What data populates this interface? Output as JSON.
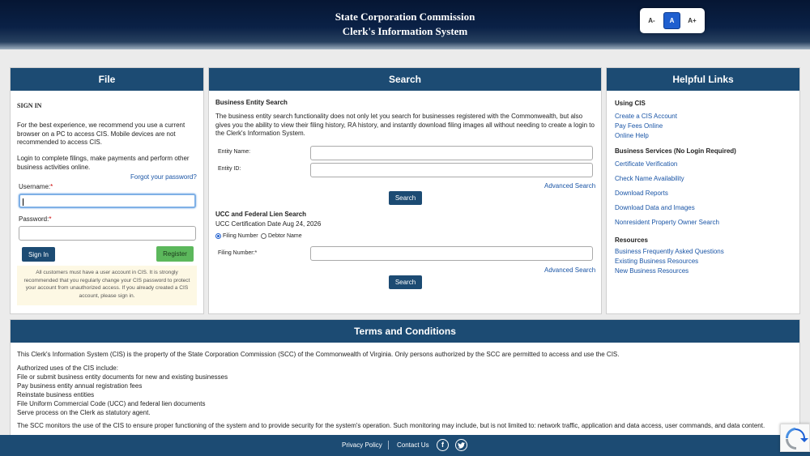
{
  "header": {
    "title_line1": "State Corporation Commission",
    "title_line2": "Clerk's Information System",
    "font_controls": [
      "A-",
      "A",
      "A+"
    ]
  },
  "file_panel": {
    "heading": "File",
    "sign_in_title": "SIGN IN",
    "experience_text": "For the best experience, we recommend you use a current browser on a PC to access CIS. Mobile devices are not recommended to access CIS.",
    "login_text": "Login to complete filings, make payments and perform other business activities online.",
    "forgot_password": "Forgot your password?",
    "username_label": "Username:",
    "password_label": "Password:",
    "required_mark": "*",
    "username_value": "",
    "password_value": "",
    "sign_in_button": "Sign In",
    "register_button": "Register",
    "notice": "All customers must have a user account in CIS. It is strongly recommended that you regularly change your CIS password to protect your account from unauthorized access. If you already created a CIS account, please sign in."
  },
  "search_panel": {
    "heading": "Search",
    "business_title": "Business Entity Search",
    "business_desc": "The business entity search functionality does not only let you search for businesses registered with the Commonwealth, but also gives you the ability to view their filing history, RA history, and instantly download filing images all without needing to create a login to the Clerk's Information System.",
    "entity_name_label": "Entity Name:",
    "entity_id_label": "Entity ID:",
    "advanced_search": "Advanced Search",
    "search_button": "Search",
    "ucc_title": "UCC and Federal Lien Search",
    "ucc_cert_date": "UCC Certification Date Aug 24, 2026",
    "radio_filing": "Filing Number",
    "radio_debtor": "Debtor Name",
    "filing_number_label": "Filing Number:",
    "required_mark": "*"
  },
  "helpful_links": {
    "heading": "Helpful Links",
    "using_cis_title": "Using CIS",
    "using_cis": [
      "Create a CIS Account",
      "Pay Fees Online",
      "Online Help"
    ],
    "business_services_title": "Business Services (No Login Required)",
    "business_services": [
      "Certificate Verification",
      "Check Name Availability",
      "Download Reports",
      "Download Data and Images",
      "Nonresident Property Owner Search"
    ],
    "resources_title": "Resources",
    "resources": [
      "Business Frequently Asked Questions",
      "Existing Business Resources",
      "New Business Resources"
    ]
  },
  "terms": {
    "heading": "Terms and Conditions",
    "intro": "This Clerk's Information System (CIS) is the property of the State Corporation Commission (SCC) of the Commonwealth of Virginia. Only persons authorized by the SCC are permitted to access and use the CIS.",
    "uses_title": "Authorized uses of the CIS include:",
    "uses": [
      "File or submit business entity documents for new and existing businesses",
      "Pay business entity annual registration fees",
      "Reinstate business entities",
      "File Uniform Commercial Code (UCC) and federal lien documents",
      "Serve process on the Clerk as statutory agent."
    ],
    "monitoring": "The SCC monitors the use of the CIS to ensure proper functioning of the system and to provide security for the system's operation. Such monitoring may include, but is not limited to: network traffic, application and data access, user commands, and data content."
  },
  "footer": {
    "privacy_policy": "Privacy Policy",
    "contact_us": "Contact Us",
    "social": [
      "facebook-icon",
      "twitter-icon"
    ]
  },
  "colors": {
    "header_dark": "#061633",
    "panel_header": "#1c4b73",
    "link": "#1a55a6",
    "register_green": "#5cb85c",
    "font_active": "#1f5fcf"
  }
}
